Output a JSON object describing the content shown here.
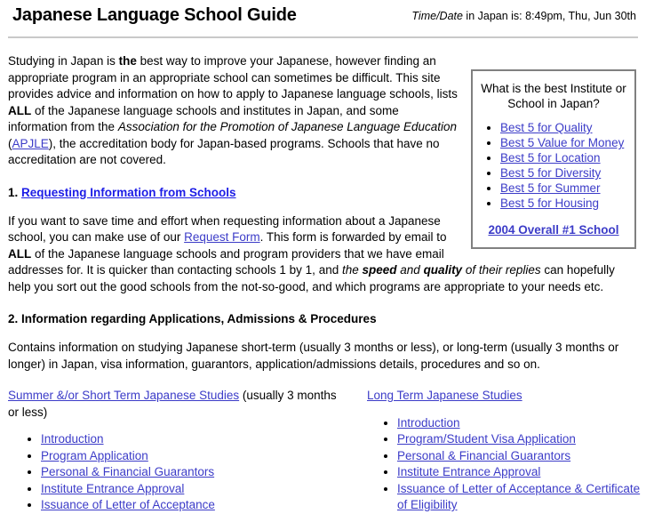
{
  "header": {
    "title": "Japanese Language School Guide",
    "timedate_label": "Time/Date",
    "timedate_text": " in Japan is: 8:49pm, Thu, Jun 30th"
  },
  "sidebar": {
    "title": "What is the best Institute or School in Japan?",
    "items": [
      {
        "label": "Best 5 for Quality"
      },
      {
        "label": "Best 5 Value for Money"
      },
      {
        "label": "Best 5 for Location"
      },
      {
        "label": "Best 5 for Diversity"
      },
      {
        "label": "Best 5 for Summer"
      },
      {
        "label": "Best 5 for Housing"
      }
    ],
    "footer_link": "2004 Overall #1 School"
  },
  "intro": {
    "p1_a": "Studying in Japan is ",
    "p1_b": "the",
    "p1_c": " best way to improve your Japanese, however finding an appropriate program in an appropriate school can sometimes be difficult. This site provides advice and information on how to apply to Japanese language schools, lists ",
    "p1_d": "ALL",
    "p1_e": " of the Japanese language schools and institutes in Japan, and some information from the ",
    "p1_f": "Association for the Promotion of Japanese Language Education",
    "p1_g": " (",
    "p1_link": "APJLE",
    "p1_h": "), the accreditation body for Japan-based programs. Schools that have no accreditation are not covered."
  },
  "section1": {
    "number": "1. ",
    "heading_link": "Requesting Information from Schools",
    "p_a": "If you want to save time and effort when requesting information about a Japanese school, you can make use of our ",
    "p_link": "Request Form",
    "p_b": ". This form is forwarded by email to ",
    "p_bold": "ALL",
    "p_c": " of the Japanese language schools and program providers that we have email addresses for. It is quicker than contacting schools 1 by 1, and ",
    "p_ital1": "the ",
    "p_bi1": "speed",
    "p_ital2": " and ",
    "p_bi2": "quality",
    "p_ital3": " of their replies",
    "p_d": " can hopefully help you sort out the good schools from the not-so-good, and which programs are appropriate to your needs etc."
  },
  "section2": {
    "heading": "2. Information regarding Applications, Admissions & Procedures",
    "paragraph": "Contains information on studying Japanese short-term (usually 3 months or less), or long-term (usually 3 months or longer) in Japan, visa information, guarantors, application/admissions details, procedures and so on."
  },
  "columns": {
    "left": {
      "head_link": "Summer &/or Short Term Japanese Studies",
      "head_rest": " (usually 3 months or less)",
      "items": [
        {
          "label": "Introduction"
        },
        {
          "label": "Program Application"
        },
        {
          "label": "Personal & Financial Guarantors"
        },
        {
          "label": "Institute Entrance Approval"
        },
        {
          "label": "Issuance of Letter of Acceptance"
        }
      ]
    },
    "right": {
      "head_link": "Long Term Japanese Studies",
      "head_rest": "",
      "items": [
        {
          "label": "Introduction"
        },
        {
          "label": "Program/Student Visa Application"
        },
        {
          "label": "Personal & Financial Guarantors"
        },
        {
          "label": "Institute Entrance Approval"
        },
        {
          "label": "Issuance of Letter of Acceptance & Certificate of Eligibility"
        }
      ]
    }
  },
  "colors": {
    "link": "#3c3cc8",
    "link_bright": "#1c1ce6",
    "rule": "#c9c9c9",
    "box_border": "#808080"
  }
}
